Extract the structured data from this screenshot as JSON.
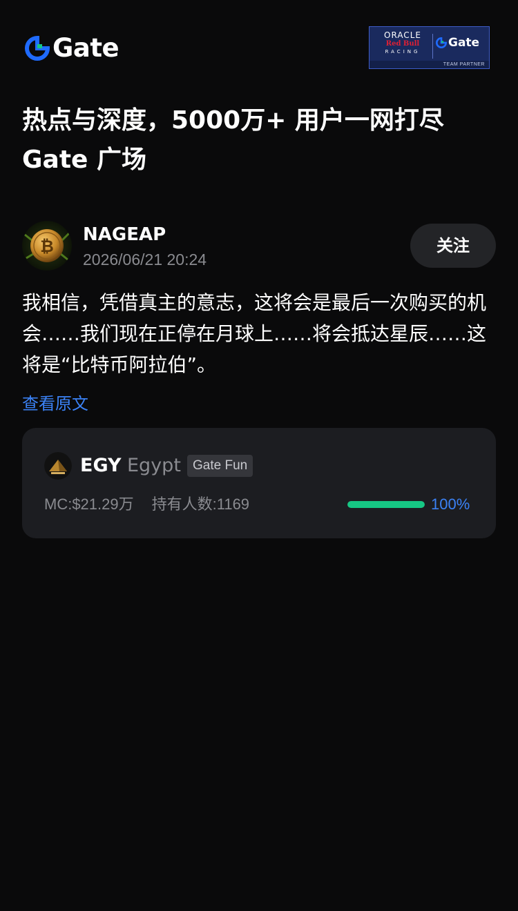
{
  "header": {
    "logo_text": "Gate",
    "partner": {
      "oracle": "ORACLE",
      "redbull": "Red Bull",
      "racing": "RACING",
      "gate": "Gate",
      "team_partner": "TEAM PARTNER"
    }
  },
  "headline": {
    "line1": "热点与深度，5000万+ 用户一网打尽",
    "line2": "Gate 广场"
  },
  "post": {
    "author": "NAGEAP",
    "timestamp": "2026/06/21 20:24",
    "follow_label": "关注",
    "text": "我相信，凭借真主的意志，这将会是最后一次购买的机会……我们现在正停在月球上……将会抵达星辰……这将是“比特币阿拉伯”。",
    "view_original_label": "查看原文"
  },
  "token": {
    "symbol": "EGY",
    "name": "Egypt",
    "tag": "Gate Fun",
    "market_cap": "MC:$21.29万",
    "holders": "持有人数:1169",
    "progress_label": "100%",
    "progress_value": 100
  },
  "colors": {
    "background": "#0a0a0b",
    "card": "#1c1d21",
    "accent_blue": "#3b82f6",
    "progress_green": "#16c784",
    "muted_text": "#8a8b90"
  }
}
